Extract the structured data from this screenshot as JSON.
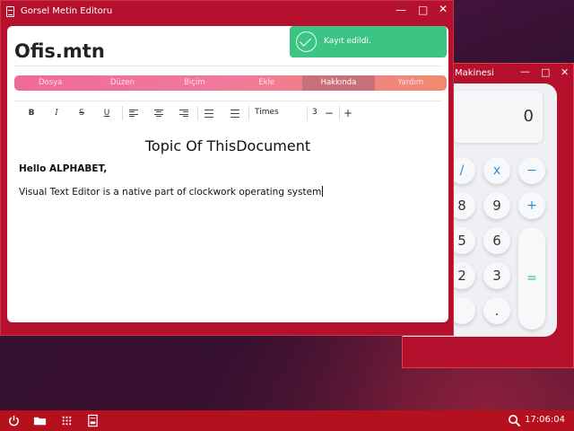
{
  "calculator": {
    "title": "Makinesi",
    "display": "0",
    "keys": {
      "divide": "/",
      "multiply": "x",
      "minus": "−",
      "eight": "8",
      "nine": "9",
      "plus": "+",
      "five": "5",
      "six": "6",
      "two": "2",
      "three": "3",
      "equals": "=",
      "decimal": "."
    },
    "controls": {
      "minimize": "—",
      "maximize": "□",
      "close": "✕"
    }
  },
  "editor": {
    "window_title": "Gorsel Metin Editoru",
    "app_name": "Ofis.mtn",
    "controls": {
      "minimize": "—",
      "maximize": "□",
      "close": "✕"
    },
    "menu": [
      "Dosya",
      "Düzen",
      "Biçim",
      "Ekle",
      "Hakkında",
      "Yardım"
    ],
    "active_menu": "Hakkında",
    "toolbar": {
      "bold": "B",
      "italic": "I",
      "strike": "S",
      "underline": "U",
      "font": "Times",
      "font_size": "3",
      "decrease": "−",
      "increase": "+"
    },
    "document": {
      "title": "Topic Of ThisDocument",
      "greeting": "Hello ALPHABET,",
      "body": "Visual Text Editor is a native part of clockwork operating system"
    }
  },
  "toast": {
    "message": "Kayıt edildi."
  },
  "taskbar": {
    "clock": "17:06:04"
  },
  "colors": {
    "window_accent": "#b5102e",
    "toast_green": "#3bc484",
    "menu_active": "#c9707a"
  }
}
